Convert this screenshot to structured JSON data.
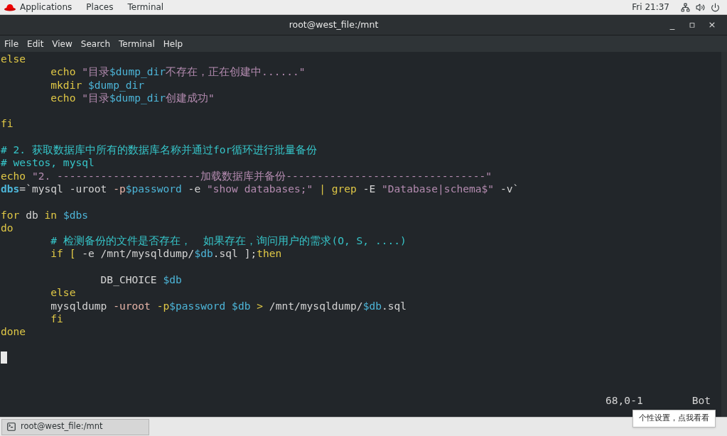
{
  "top_bar": {
    "menus": [
      "Applications",
      "Places",
      "Terminal"
    ],
    "clock": "Fri 21:37"
  },
  "window": {
    "title": "root@west_file:/mnt",
    "controls": [
      "_",
      "▫",
      "×"
    ]
  },
  "menu_bar": [
    "File",
    "Edit",
    "View",
    "Search",
    "Terminal",
    "Help"
  ],
  "editor": {
    "lines": [
      {
        "kind": "code",
        "segments": [
          {
            "kind": "keyword",
            "text": "else"
          }
        ]
      },
      {
        "kind": "code",
        "segments": [
          {
            "kind": "keyword",
            "text": "        echo "
          },
          {
            "kind": "string",
            "text": "\"目录"
          },
          {
            "kind": "variable",
            "text": "$dump_dir"
          },
          {
            "kind": "string",
            "text": "不存在，正在创建中......\""
          }
        ]
      },
      {
        "kind": "code",
        "segments": [
          {
            "kind": "keyword",
            "text": "        mkdir "
          },
          {
            "kind": "variable",
            "text": "$dump_dir"
          }
        ]
      },
      {
        "kind": "code",
        "segments": [
          {
            "kind": "keyword",
            "text": "        echo "
          },
          {
            "kind": "string",
            "text": "\"目录"
          },
          {
            "kind": "variable",
            "text": "$dump_dir"
          },
          {
            "kind": "string",
            "text": "创建成功\""
          }
        ]
      },
      {
        "kind": "blank"
      },
      {
        "kind": "code",
        "segments": [
          {
            "kind": "keyword",
            "text": "fi"
          }
        ]
      },
      {
        "kind": "blank"
      },
      {
        "kind": "code",
        "segments": [
          {
            "kind": "comment",
            "text": "# 2. 获取数据库中所有的数据库名称并通过for循环进行批量备份"
          }
        ]
      },
      {
        "kind": "code",
        "segments": [
          {
            "kind": "comment",
            "text": "# westos, mysql"
          }
        ]
      },
      {
        "kind": "code",
        "segments": [
          {
            "kind": "keyword",
            "text": "echo "
          },
          {
            "kind": "string",
            "text": "\"2. -----------------------加载数据库并备份--------------------------------\""
          }
        ]
      },
      {
        "kind": "code",
        "segments": [
          {
            "kind": "name",
            "text": "dbs"
          },
          {
            "kind": "plain",
            "text": "=`mysql -uroot "
          },
          {
            "kind": "option",
            "text": "-p"
          },
          {
            "kind": "variable",
            "text": "$password"
          },
          {
            "kind": "plain",
            "text": " -e "
          },
          {
            "kind": "string",
            "text": "\"show databases;\" "
          },
          {
            "kind": "keyword",
            "text": "| grep"
          },
          {
            "kind": "plain",
            "text": " -E "
          },
          {
            "kind": "string",
            "text": "\"Database|schema$\""
          },
          {
            "kind": "plain",
            "text": " -v`"
          }
        ]
      },
      {
        "kind": "blank"
      },
      {
        "kind": "code",
        "segments": [
          {
            "kind": "keyword",
            "text": "for"
          },
          {
            "kind": "plain",
            "text": " db "
          },
          {
            "kind": "keyword",
            "text": "in "
          },
          {
            "kind": "variable",
            "text": "$dbs"
          }
        ]
      },
      {
        "kind": "code",
        "segments": [
          {
            "kind": "keyword",
            "text": "do"
          }
        ]
      },
      {
        "kind": "code",
        "segments": [
          {
            "kind": "comment",
            "text": "        # 检测备份的文件是否存在，  如果存在，询问用户的需求(O, S, ....)"
          }
        ]
      },
      {
        "kind": "code",
        "segments": [
          {
            "kind": "keyword",
            "text": "        if ["
          },
          {
            "kind": "plain",
            "text": " -e /mnt/mysqldump/"
          },
          {
            "kind": "variable",
            "text": "$db"
          },
          {
            "kind": "plain",
            "text": ".sql ];"
          },
          {
            "kind": "keyword",
            "text": "then"
          }
        ]
      },
      {
        "kind": "blank"
      },
      {
        "kind": "code",
        "segments": [
          {
            "kind": "plain",
            "text": "                DB_CHOICE "
          },
          {
            "kind": "variable",
            "text": "$db"
          }
        ]
      },
      {
        "kind": "code",
        "segments": [
          {
            "kind": "keyword",
            "text": "        else"
          }
        ]
      },
      {
        "kind": "code",
        "segments": [
          {
            "kind": "plain",
            "text": "        mysqldump "
          },
          {
            "kind": "option",
            "text": "-uroot "
          },
          {
            "kind": "keyword",
            "text": "-p"
          },
          {
            "kind": "variable",
            "text": "$password $db "
          },
          {
            "kind": "keyword",
            "text": ">"
          },
          {
            "kind": "plain",
            "text": " /mnt/mysqldump/"
          },
          {
            "kind": "variable",
            "text": "$db"
          },
          {
            "kind": "plain",
            "text": ".sql"
          }
        ]
      },
      {
        "kind": "code",
        "segments": [
          {
            "kind": "keyword",
            "text": "        fi"
          }
        ]
      },
      {
        "kind": "code",
        "segments": [
          {
            "kind": "keyword",
            "text": "done"
          }
        ]
      }
    ],
    "status": {
      "position": "68,0-1",
      "scroll": "Bot"
    }
  },
  "taskbar": {
    "task": "root@west_file:/mnt",
    "tooltip": "个性设置，点我看看"
  }
}
